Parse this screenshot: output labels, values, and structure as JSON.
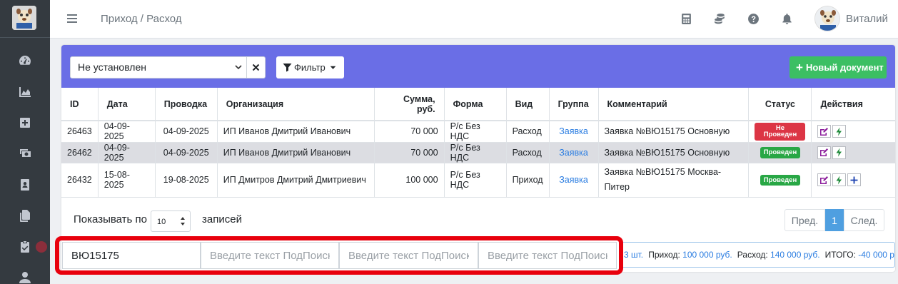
{
  "topbar": {
    "breadcrumb": "Приход / Расход",
    "username": "Виталий",
    "icons": [
      "calculator-icon",
      "coins-icon",
      "help-icon",
      "bell-icon"
    ]
  },
  "sidebar": {
    "icons": [
      "dashboard-icon",
      "chart-area-icon",
      "plus-square-icon",
      "money-icon",
      "id-badge-icon",
      "copy-icon",
      "clipboard-check-icon",
      "user-icon"
    ]
  },
  "toolbar": {
    "status_value": "Не установлен",
    "filter_label": "Фильтр",
    "new_document_label": "Новый документ"
  },
  "table": {
    "headers": [
      "ID",
      "Дата",
      "Проводка",
      "Организация",
      "Сумма, руб.",
      "Форма",
      "Вид",
      "Группа",
      "Комментарий",
      "Статус",
      "Действия"
    ],
    "rows": [
      {
        "id": "26463",
        "date": "04-09-2025",
        "posting": "04-09-2025",
        "org": "ИП Иванов Дмитрий Иванович",
        "sum": "70 000",
        "form": "Р/с Без НДС",
        "kind": "Расход",
        "group": "Заявка",
        "comment": "Заявка №ВЮ15175 Основную",
        "status": "Не Проведен",
        "status_color": "#dc3545"
      },
      {
        "id": "26462",
        "date": "04-09-2025",
        "posting": "04-09-2025",
        "org": "ИП Иванов Дмитрий Иванович",
        "sum": "70 000",
        "form": "Р/с Без НДС",
        "kind": "Расход",
        "group": "Заявка",
        "comment": "Заявка №ВЮ15175 Основную",
        "status": "Проведен",
        "status_color": "#28a745"
      },
      {
        "id": "26432",
        "date": "15-08-2025",
        "posting": "19-08-2025",
        "org": "ИП Дмитров Дмитрий Дмитриевич",
        "sum": "100 000",
        "form": "Р/с Без НДС",
        "kind": "Приход",
        "group": "Заявка",
        "comment": "Заявка №ВЮ15175 Москва-Питер",
        "status": "Проведен",
        "status_color": "#28a745"
      }
    ]
  },
  "pagination": {
    "show_label": "Показывать по",
    "page_size": "10",
    "records_label": "записей",
    "prev": "Пред.",
    "current": "1",
    "next": "След."
  },
  "subsearch": {
    "value_1": "ВЮ15175",
    "placeholder": "Введите текст ПодПоиск"
  },
  "totals": {
    "count": "3 шт.",
    "income_label": "Приход:",
    "income_value": "100 000 руб.",
    "expense_label": "Расход:",
    "expense_value": "140 000 руб.",
    "total_label": "ИТОГО:",
    "total_value": "-40 000 р"
  },
  "colors": {
    "header_bg": "#6a6ee6",
    "success": "#3cbf63",
    "danger": "#dc3545",
    "link": "#2b7de1",
    "highlight": "#e8000d"
  }
}
